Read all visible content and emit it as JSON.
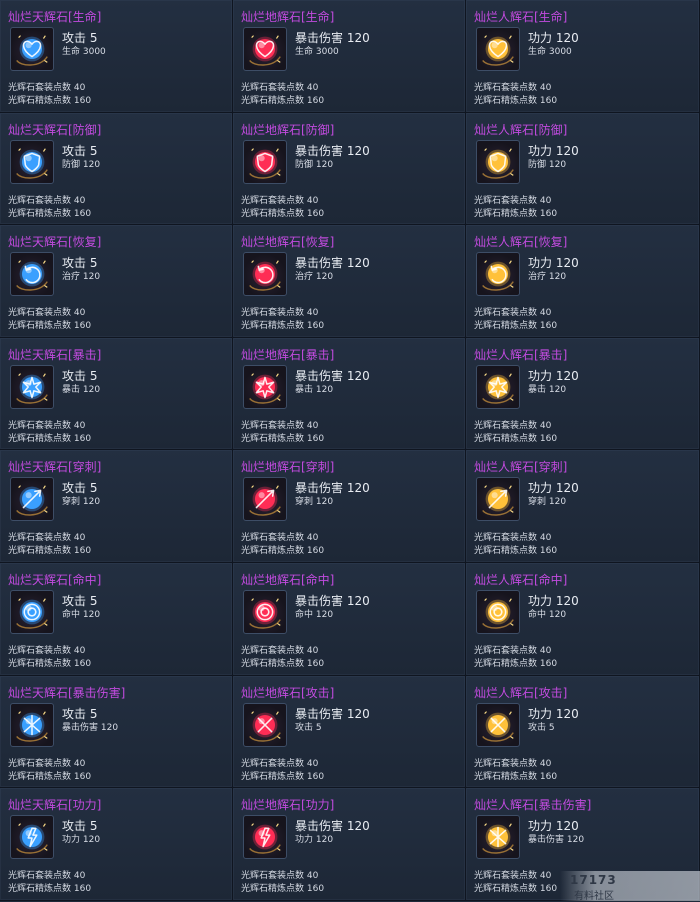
{
  "colors": {
    "title": "#c24bdf",
    "gem_blue": "#3aa0ff",
    "gem_red": "#ff2d55",
    "gem_gold": "#ffc13a"
  },
  "cells": [
    {
      "title": "灿烂天辉石[生命]",
      "stat1": "攻击 5",
      "stat2": "生命 3000",
      "set": "光辉石套装点数 40",
      "refine": "光辉石精炼点数 160",
      "gem": "blue",
      "icon": "heart-icon"
    },
    {
      "title": "灿烂地辉石[生命]",
      "stat1": "暴击伤害 120",
      "stat2": "生命 3000",
      "set": "光辉石套装点数 40",
      "refine": "光辉石精炼点数 160",
      "gem": "red",
      "icon": "heart-icon"
    },
    {
      "title": "灿烂人辉石[生命]",
      "stat1": "功力 120",
      "stat2": "生命 3000",
      "set": "光辉石套装点数 40",
      "refine": "光辉石精炼点数 160",
      "gem": "gold",
      "icon": "heart-icon"
    },
    {
      "title": "灿烂天辉石[防御]",
      "stat1": "攻击 5",
      "stat2": "防御 120",
      "set": "光辉石套装点数 40",
      "refine": "光辉石精炼点数 160",
      "gem": "blue",
      "icon": "shield-icon"
    },
    {
      "title": "灿烂地辉石[防御]",
      "stat1": "暴击伤害 120",
      "stat2": "防御 120",
      "set": "光辉石套装点数 40",
      "refine": "光辉石精炼点数 160",
      "gem": "red",
      "icon": "shield-icon"
    },
    {
      "title": "灿烂人辉石[防御]",
      "stat1": "功力 120",
      "stat2": "防御 120",
      "set": "光辉石套装点数 40",
      "refine": "光辉石精炼点数 160",
      "gem": "gold",
      "icon": "shield-icon"
    },
    {
      "title": "灿烂天辉石[恢复]",
      "stat1": "攻击 5",
      "stat2": "治疗 120",
      "set": "光辉石套装点数 40",
      "refine": "光辉石精炼点数 160",
      "gem": "blue",
      "icon": "recovery-icon"
    },
    {
      "title": "灿烂地辉石[恢复]",
      "stat1": "暴击伤害 120",
      "stat2": "治疗 120",
      "set": "光辉石套装点数 40",
      "refine": "光辉石精炼点数 160",
      "gem": "red",
      "icon": "recovery-icon"
    },
    {
      "title": "灿烂人辉石[恢复]",
      "stat1": "功力 120",
      "stat2": "治疗 120",
      "set": "光辉石套装点数 40",
      "refine": "光辉石精炼点数 160",
      "gem": "gold",
      "icon": "recovery-icon"
    },
    {
      "title": "灿烂天辉石[暴击]",
      "stat1": "攻击 5",
      "stat2": "暴击 120",
      "set": "光辉石套装点数 40",
      "refine": "光辉石精炼点数 160",
      "gem": "blue",
      "icon": "burst-icon"
    },
    {
      "title": "灿烂地辉石[暴击]",
      "stat1": "暴击伤害 120",
      "stat2": "暴击 120",
      "set": "光辉石套装点数 40",
      "refine": "光辉石精炼点数 160",
      "gem": "red",
      "icon": "burst-icon"
    },
    {
      "title": "灿烂人辉石[暴击]",
      "stat1": "功力 120",
      "stat2": "暴击 120",
      "set": "光辉石套装点数 40",
      "refine": "光辉石精炼点数 160",
      "gem": "gold",
      "icon": "burst-icon"
    },
    {
      "title": "灿烂天辉石[穿刺]",
      "stat1": "攻击 5",
      "stat2": "穿刺 120",
      "set": "光辉石套装点数 40",
      "refine": "光辉石精炼点数 160",
      "gem": "blue",
      "icon": "pierce-icon"
    },
    {
      "title": "灿烂地辉石[穿刺]",
      "stat1": "暴击伤害 120",
      "stat2": "穿刺 120",
      "set": "光辉石套装点数 40",
      "refine": "光辉石精炼点数 160",
      "gem": "red",
      "icon": "pierce-icon"
    },
    {
      "title": "灿烂人辉石[穿刺]",
      "stat1": "功力 120",
      "stat2": "穿刺 120",
      "set": "光辉石套装点数 40",
      "refine": "光辉石精炼点数 160",
      "gem": "gold",
      "icon": "pierce-icon"
    },
    {
      "title": "灿烂天辉石[命中]",
      "stat1": "攻击 5",
      "stat2": "命中 120",
      "set": "光辉石套装点数 40",
      "refine": "光辉石精炼点数 160",
      "gem": "blue",
      "icon": "target-icon"
    },
    {
      "title": "灿烂地辉石[命中]",
      "stat1": "暴击伤害 120",
      "stat2": "命中 120",
      "set": "光辉石套装点数 40",
      "refine": "光辉石精炼点数 160",
      "gem": "red",
      "icon": "target-icon"
    },
    {
      "title": "灿烂人辉石[命中]",
      "stat1": "功力 120",
      "stat2": "命中 120",
      "set": "光辉石套装点数 40",
      "refine": "光辉石精炼点数 160",
      "gem": "gold",
      "icon": "target-icon"
    },
    {
      "title": "灿烂天辉石[暴击伤害]",
      "stat1": "攻击 5",
      "stat2": "暴击伤害 120",
      "set": "光辉石套装点数 40",
      "refine": "光辉石精炼点数 160",
      "gem": "blue",
      "icon": "crit-damage-icon"
    },
    {
      "title": "灿烂地辉石[攻击]",
      "stat1": "暴击伤害 120",
      "stat2": "攻击 5",
      "set": "光辉石套装点数 40",
      "refine": "光辉石精炼点数 160",
      "gem": "red",
      "icon": "attack-icon"
    },
    {
      "title": "灿烂人辉石[攻击]",
      "stat1": "功力 120",
      "stat2": "攻击 5",
      "set": "光辉石套装点数 40",
      "refine": "光辉石精炼点数 160",
      "gem": "gold",
      "icon": "attack-icon"
    },
    {
      "title": "灿烂天辉石[功力]",
      "stat1": "攻击 5",
      "stat2": "功力 120",
      "set": "光辉石套装点数 40",
      "refine": "光辉石精炼点数 160",
      "gem": "blue",
      "icon": "power-icon"
    },
    {
      "title": "灿烂地辉石[功力]",
      "stat1": "暴击伤害 120",
      "stat2": "功力 120",
      "set": "光辉石套装点数 40",
      "refine": "光辉石精炼点数 160",
      "gem": "red",
      "icon": "power-icon"
    },
    {
      "title": "灿烂人辉石[暴击伤害]",
      "stat1": "功力 120",
      "stat2": "暴击伤害 120",
      "set": "光辉石套装点数 40",
      "refine": "光辉石精炼点数 160",
      "gem": "gold",
      "icon": "crit-damage-icon"
    }
  ],
  "watermark": {
    "logo": "17173",
    "subtitle": "有料社区"
  }
}
